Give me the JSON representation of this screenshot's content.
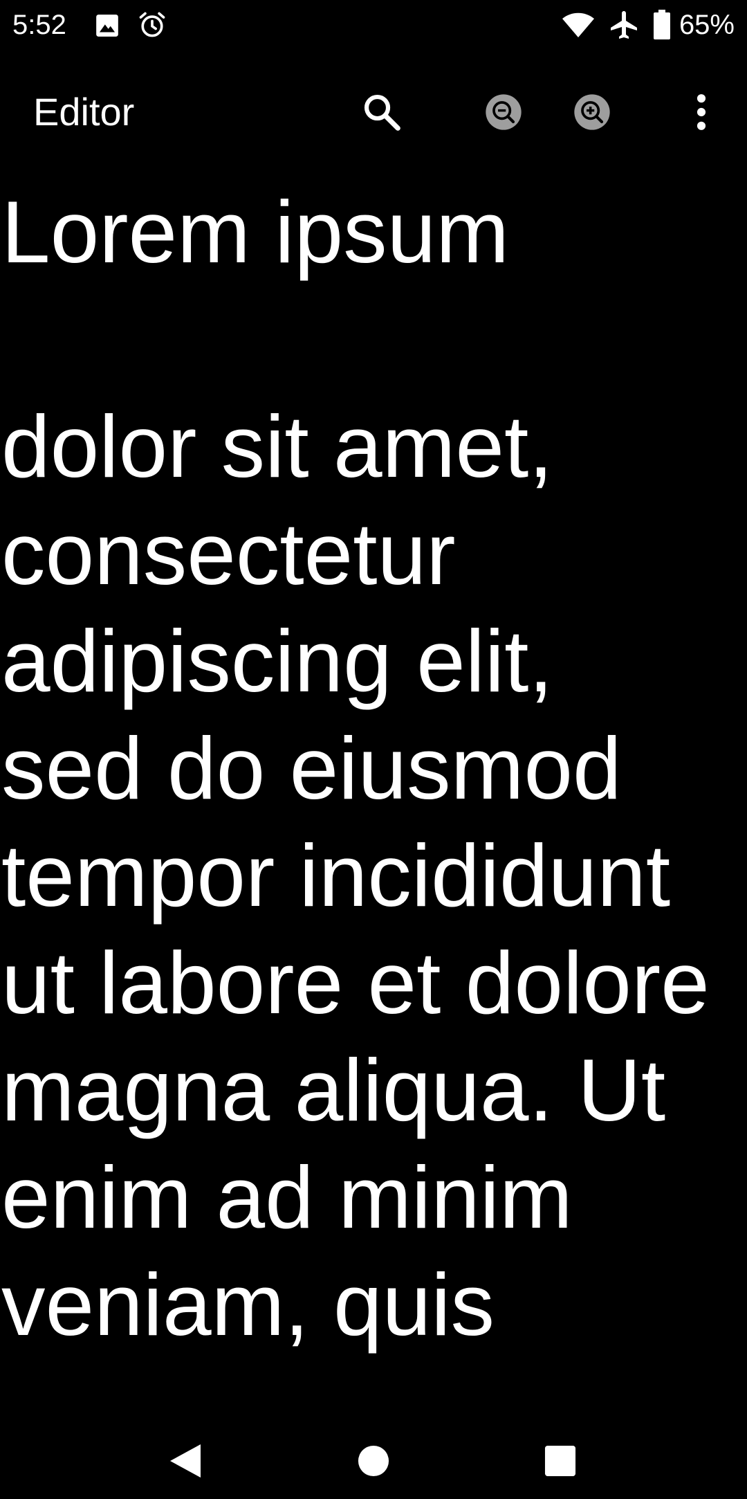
{
  "status_bar": {
    "time": "5:52",
    "battery_percent": "65%",
    "battery_level": 0.65,
    "icons": [
      "image-icon",
      "alarm-icon",
      "wifi-icon",
      "airplane-mode-icon",
      "battery-icon"
    ]
  },
  "app_bar": {
    "title": "Editor",
    "actions": [
      "search-icon",
      "zoom-out-icon",
      "zoom-in-icon",
      "more-vert-icon"
    ]
  },
  "editor": {
    "content": "Lorem ipsum\n\ndolor sit amet,\nconsectetur\nadipiscing elit,\nsed do eiusmod\ntempor incididunt\nut labore et dolore\nmagna aliqua. Ut\nenim ad minim\nveniam, quis"
  },
  "nav_bar": {
    "buttons": [
      "back-icon",
      "home-icon",
      "recents-icon"
    ]
  },
  "colors": {
    "background": "#000000",
    "foreground": "#ffffff",
    "zoom_button_fill": "#9e9e9e"
  }
}
